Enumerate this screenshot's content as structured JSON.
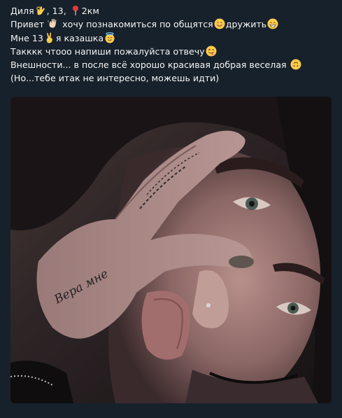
{
  "message": {
    "line1": {
      "name": "Диля",
      "rest1": ", 13, ",
      "distance": "2км",
      "icons": [
        "ok-hand-icon",
        "location-pin-icon"
      ]
    },
    "line2": {
      "part1": "Привет ",
      "part2": " хочу познакомиться по общятся",
      "part3": "дружить",
      "icons": [
        "waving-hand-icon",
        "smiling-face-icon",
        "grinning-face-icon"
      ]
    },
    "line3": {
      "part1": "Мне 13",
      "part2": "я казашка",
      "icons": [
        "victory-hand-icon",
        "halo-face-icon"
      ]
    },
    "line4": {
      "text": "Такккк чтооо напиши пожалуйста отвечу",
      "icons": [
        "zany-face-icon"
      ]
    },
    "line5": {
      "text": "Внешности... в после всё хорошо красивая добрая веселая ",
      "icons": [
        "upside-down-face-icon"
      ]
    },
    "line6": {
      "text": "(Но...тебе итак не интересно, можешь идти)"
    }
  },
  "photo": {
    "description_icon": "selfie-photo",
    "tattoo_text": "Вера мне"
  },
  "colors": {
    "background": "#17212b",
    "text": "#f5f5f5",
    "emoji_yellow": "#ffcb4c",
    "pin_red": "#e23a3a"
  }
}
